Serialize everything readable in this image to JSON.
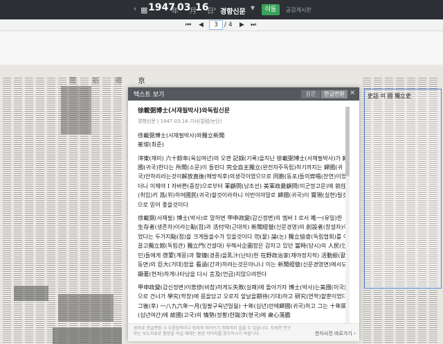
{
  "topbar": {
    "year": "1947",
    "year_suffix": "年",
    "month": "03",
    "month_suffix": "月",
    "day": "16",
    "day_suffix": "日",
    "newspaper": "경향신문",
    "issue_button": "이동",
    "share": "공감게시판"
  },
  "pager": {
    "first": "⏮",
    "prev": "◀",
    "current": "3",
    "separator": "/",
    "total": "4",
    "next": "▶",
    "last": "⏭"
  },
  "modal": {
    "title": "텍스트 보기",
    "tab_original": "원문",
    "tab_converted": "한글변환",
    "close": "✕",
    "article_title": "徐載弼博士(서재필박사)와독립신문",
    "article_meta": "경향신문 | 1947.03.16 기사(칼럼/논단)",
    "headline1": "徐載弼博士(서재필박사)와獨立新聞",
    "headline2": "崔埈(최준)",
    "para1": "滓東(재미) 六十餘年(육십여년)의 오랜 記錄(기록)을지닌 徐載弼博士(서재필박사)가 歸國(귀국)한다는 所聞(소문)이 들린다 完全自主獨立(완전자주독립)하기까지는 歸國(귀국)안하리라는것이解放直後(해방직후)의생각이였으므로 同胞(동포)들의齊唱(찬연)이었더니 이제야 I 자바쁜(중장)으로부터 軍顧問(남조선) 美軍政最顧問(미군정고문)에 就任(취임)키 爲(위)하여國民(귀국)할것이라하니 이번이야말로 歸國(귀국)이 實現(실현)될것으로 믿어 좋을것이다",
    "para2": "徐載弼(서재필) 博士(박사)로 말하면 甲申政變(갑신정변)의 멤버 I 로서 唯一(유일)한 生存者(생존자)이라는點(점)과 活付약(근대적) 新聞經營(신문경영)의 創設者(창설자)이었다는 두가지點(점)을 크게들을수가 있을것이다 勿(물) 論(논) 獨立協會(독립협회)를 이끌고獨立館(독립관) 獨立門(건설대) 우해서企圖함은 갑자고 있던 當時(당시)의 人民(인민)들에게 啓蒙(계몽)과 警鐘(경종)을乳汁(난타)한 在野政治家(재야정치적) 活動振(활동면)의 巨大(거대)함을 看過(간과)하려는것은아니나 이는 新聞經營(신문경영면)에서도 顯著(현저)하게나타남을 다시 言及(언급)치않으려한다",
    "para3": "甲申政變(갑신정변)이悲慘(비참)하게도失敗(실패)에 돌아가자 博士(박사)는美國(미국)으로 건너가 學究(학창)에 몸을담고 오로지 앞날을期待(기대)하고 研究(연학)할뿐이었다 그後(후) 一八九六年一月(일팔구육년일월) 十年(십년)만에歸國(귀국)하고 그는 十年間(십년여간)에 故國(고국)의 情勢(정황)한跋涉(형국)에 衆心落膽",
    "footer_note": "원자료 한글변환 시 두음법칙이나 원자의 띄어쓰기 정확하지 않을 수 있습니다. 자세한 연구 또는 보도자료로 활용을 하실 때에는 원문 이미지를 참조하시기 바랍니다.",
    "report": "한자사전 바로가기 ›"
  },
  "newspaper_page": {
    "masthead": "聞 新 鄕 京",
    "right_panel_title": "史話 의 國 獨立史"
  },
  "colors": {
    "topbar_bg": "#2c3035",
    "issue_button": "#3aa15a",
    "selection_border": "#4a7bd0",
    "modal_header": "#55585d"
  }
}
